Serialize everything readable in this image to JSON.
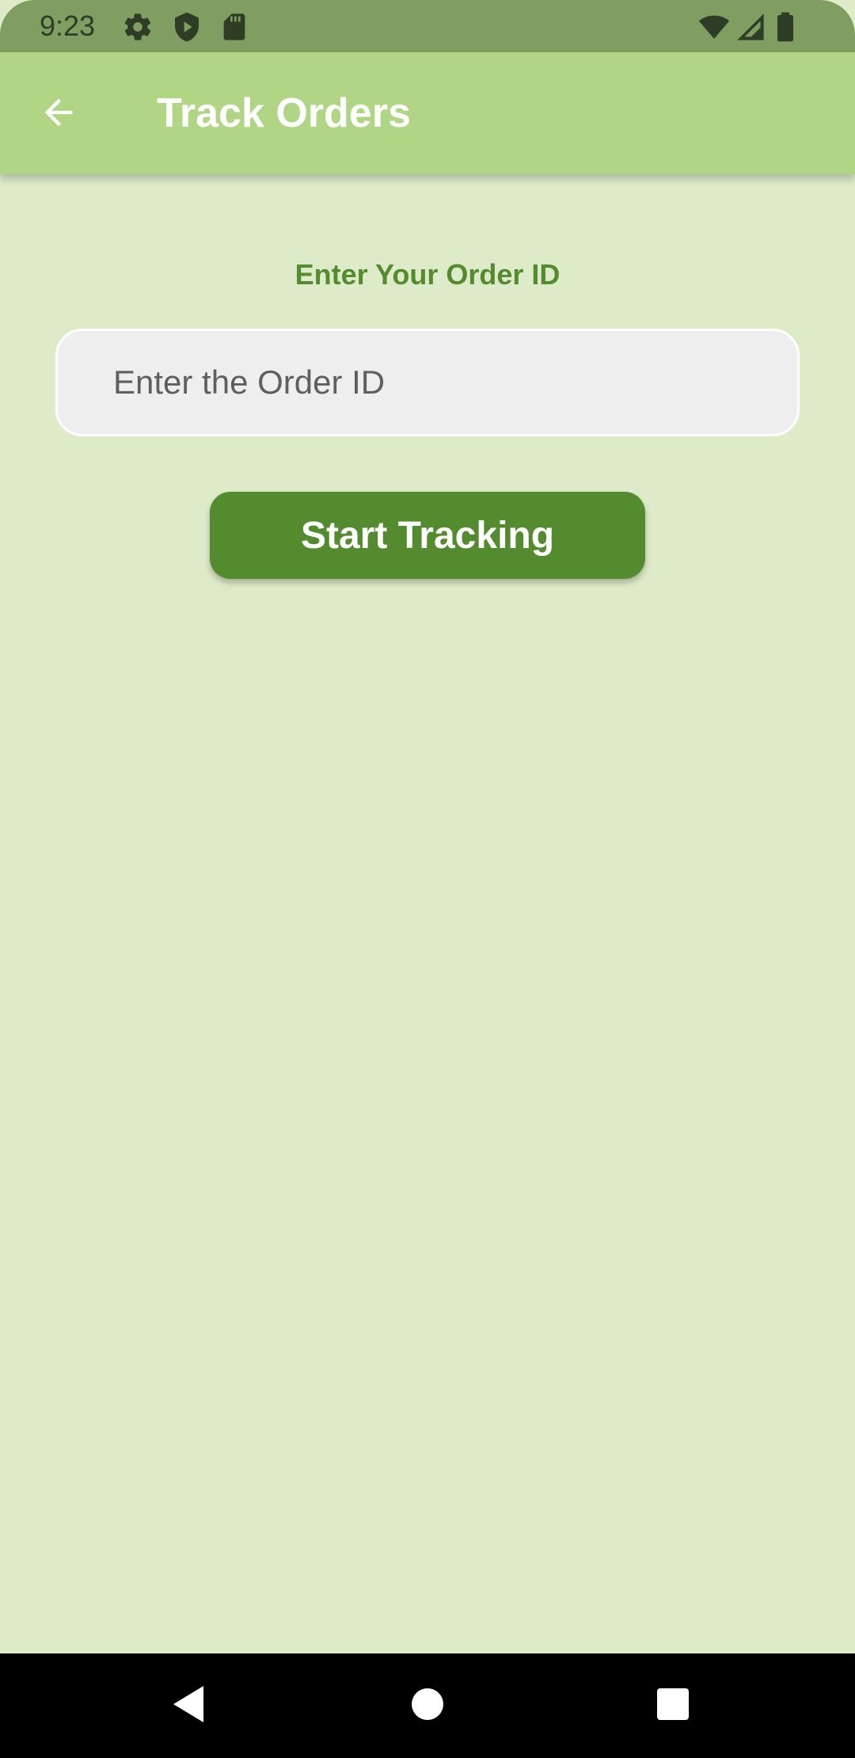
{
  "status_bar": {
    "time": "9:23",
    "icons": [
      "gear-icon",
      "shield-icon",
      "sd-card-icon",
      "wifi-icon",
      "signal-icon",
      "battery-icon"
    ]
  },
  "app_bar": {
    "title": "Track Orders",
    "back_icon": "arrow-left-icon"
  },
  "form": {
    "label": "Enter Your Order ID",
    "order_input": {
      "value": "",
      "placeholder": "Enter the Order ID"
    },
    "start_button_label": "Start Tracking"
  },
  "nav_bar": {
    "icons": [
      "back-triangle-icon",
      "home-circle-icon",
      "recents-square-icon"
    ]
  },
  "colors": {
    "background": "#deebc9",
    "status_bar": "#809e62",
    "app_bar": "#b0d685",
    "accent": "#558b2f",
    "input_fill": "#eeeeee",
    "nav_bar": "#000000"
  }
}
